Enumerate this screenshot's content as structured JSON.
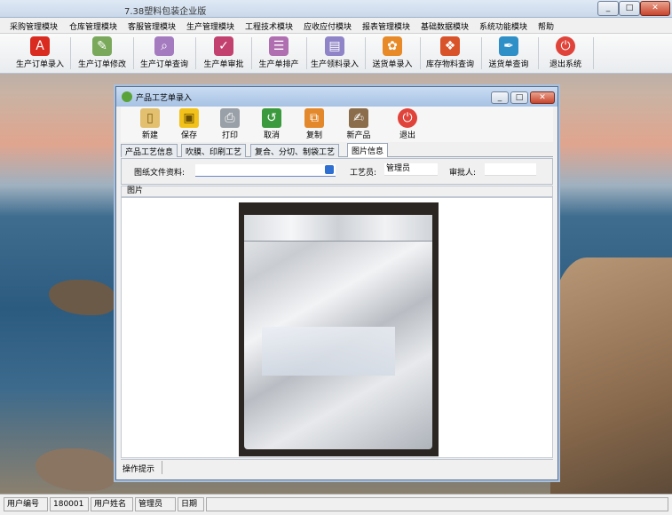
{
  "app": {
    "title": "7.38塑料包装企业版"
  },
  "menu": [
    "采购管理模块",
    "仓库管理模块",
    "客服管理模块",
    "生产管理模块",
    "工程技术模块",
    "应收应付模块",
    "报表管理模块",
    "基础数据模块",
    "系统功能模块",
    "帮助"
  ],
  "toolbar": [
    {
      "label": "生产订单录入",
      "icon": "pdf-icon"
    },
    {
      "label": "生产订单修改",
      "icon": "edit-icon"
    },
    {
      "label": "生产订单查询",
      "icon": "search-doc-icon"
    },
    {
      "label": "生产单审批",
      "icon": "approve-icon"
    },
    {
      "label": "生产单排产",
      "icon": "schedule-icon"
    },
    {
      "label": "生产领料录入",
      "icon": "material-icon"
    },
    {
      "label": "送货单录入",
      "icon": "flower-icon"
    },
    {
      "label": "库存物料查询",
      "icon": "inventory-icon"
    },
    {
      "label": "送货单查询",
      "icon": "feather-icon"
    },
    {
      "label": "退出系统",
      "icon": "power-icon"
    }
  ],
  "window": {
    "title": "产品工艺单录入",
    "buttons": [
      {
        "label": "新建",
        "icon": "new-doc-icon"
      },
      {
        "label": "保存",
        "icon": "save-icon"
      },
      {
        "label": "打印",
        "icon": "print-icon"
      },
      {
        "label": "取消",
        "icon": "cancel-icon"
      },
      {
        "label": "复制",
        "icon": "copy-icon"
      },
      {
        "label": "新产品",
        "icon": "new-product-icon"
      },
      {
        "label": "退出",
        "icon": "exit-icon"
      }
    ],
    "tabs": [
      "产品工艺信息",
      "吹膜、印刷工艺",
      "复合、分切、制袋工艺",
      "图片信息"
    ],
    "active_tab": "图片信息",
    "fields": {
      "drawing_label": "图纸文件资料:",
      "drawing_value": "",
      "engineer_label": "工艺员:",
      "engineer_value": "管理员",
      "approver_label": "审批人:",
      "approver_value": ""
    },
    "picture_label": "图片",
    "hint_label": "操作提示"
  },
  "statusbar": {
    "user_id_label": "用户编号",
    "user_id": "180001",
    "user_name_label": "用户姓名",
    "user_name": "管理员",
    "date_label": "日期"
  },
  "colors": {
    "accent": "#c9442c",
    "tab_border": "#9aa7b8",
    "input_underline": "#6a87c6"
  }
}
